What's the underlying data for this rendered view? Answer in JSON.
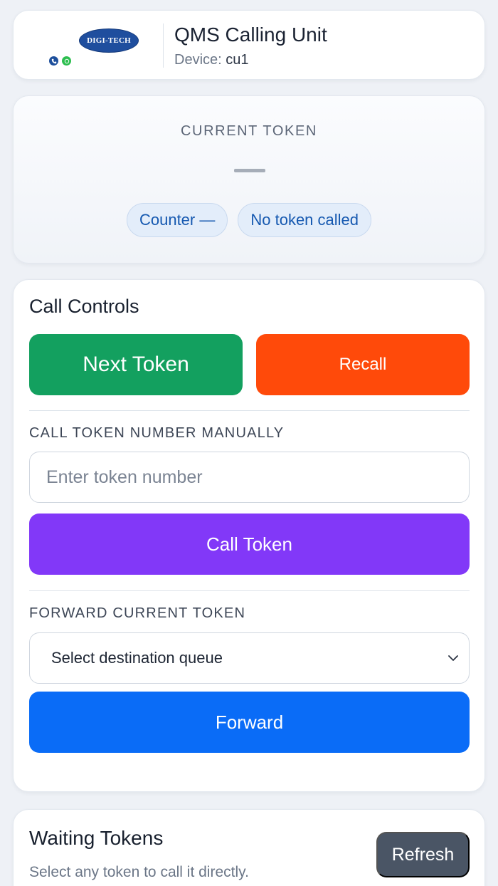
{
  "header": {
    "logo_text": "DIGI-TECH",
    "contact_icons": [
      "phone-icon",
      "whatsapp-icon"
    ],
    "title": "QMS Calling Unit",
    "device_label": "Device:",
    "device_id": "cu1"
  },
  "current_token": {
    "label": "CURRENT TOKEN",
    "value": "—",
    "counter_pill": "Counter —",
    "status_pill": "No token called"
  },
  "controls": {
    "title": "Call Controls",
    "next_button": "Next Token",
    "recall_button": "Recall",
    "manual_label": "CALL TOKEN NUMBER MANUALLY",
    "manual_placeholder": "Enter token number",
    "call_button": "Call Token",
    "forward_label": "FORWARD CURRENT TOKEN",
    "forward_select": "Select destination queue",
    "forward_button": "Forward"
  },
  "waiting": {
    "title": "Waiting Tokens",
    "subtitle": "Select any token to call it directly.",
    "refresh_button": "Refresh"
  },
  "colors": {
    "next": "#13a05f",
    "recall": "#ff4a0a",
    "call": "#8238f8",
    "forward": "#0a6cf7",
    "refresh": "#4a5565",
    "pill_text": "#1558b0"
  }
}
